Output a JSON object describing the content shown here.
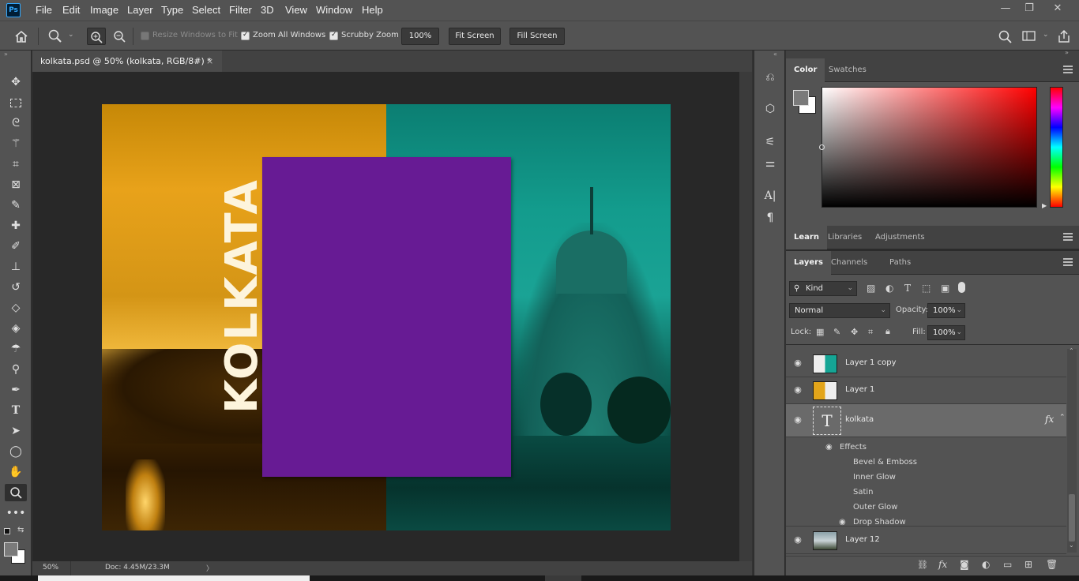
{
  "app": {
    "logo": "Ps"
  },
  "menu": [
    "File",
    "Edit",
    "Image",
    "Layer",
    "Type",
    "Select",
    "Filter",
    "3D",
    "View",
    "Window",
    "Help"
  ],
  "window_controls": {
    "minimize": "—",
    "restore": "❐",
    "close": "✕"
  },
  "options": {
    "resize_windows": "Resize Windows to Fit",
    "zoom_all": "Zoom All Windows",
    "scrubby": "Scrubby Zoom",
    "zoom_value": "100%",
    "fit_screen": "Fit Screen",
    "fill_screen": "Fill Screen"
  },
  "document": {
    "tab_title": "kolkata.psd @ 50% (kolkata, RGB/8#) *",
    "close": "×",
    "artwork_text": "KOLKATA"
  },
  "status": {
    "zoom": "50%",
    "doc": "Doc: 4.45M/23.3M",
    "arrow": "〉"
  },
  "color_panel": {
    "tabs": [
      "Color",
      "Swatches"
    ],
    "hue": 0
  },
  "learn_panel": {
    "tabs": [
      "Learn",
      "Libraries",
      "Adjustments"
    ]
  },
  "layers_panel": {
    "tabs": [
      "Layers",
      "Channels",
      "Paths"
    ],
    "kind": "Kind",
    "blend_mode": "Normal",
    "opacity_label": "Opacity:",
    "opacity": "100%",
    "lock_label": "Lock:",
    "fill_label": "Fill:",
    "fill": "100%",
    "layers": [
      {
        "name": "Layer 1 copy"
      },
      {
        "name": "Layer 1"
      },
      {
        "name": "kolkata",
        "type_glyph": "T",
        "fx": "fx"
      },
      {
        "name": "Layer 12"
      }
    ],
    "effects_label": "Effects",
    "effects": [
      "Bevel & Emboss",
      "Inner Glow",
      "Satin",
      "Outer Glow",
      "Drop Shadow"
    ]
  },
  "colors": {
    "accent": "#31a8ff",
    "purple": "#671b94",
    "teal": "#15a595",
    "orange": "#e3a51a"
  }
}
